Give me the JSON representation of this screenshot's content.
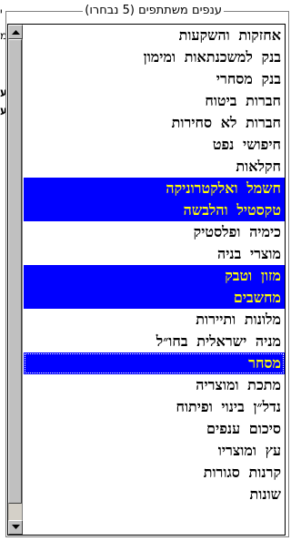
{
  "edge_fragments": [
    "י",
    "מ",
    "ע",
    "ע"
  ],
  "groupbox": {
    "title": "ענפים משתתפים (5 נבחרו)"
  },
  "list": {
    "items": [
      {
        "label": "אחזקות והשקעות",
        "selected": false
      },
      {
        "label": "בנק למשכנתאות ומימון",
        "selected": false
      },
      {
        "label": "בנק מסחרי",
        "selected": false
      },
      {
        "label": "חברות ביטוח",
        "selected": false
      },
      {
        "label": "חברות לא סחירות",
        "selected": false
      },
      {
        "label": "חיפושי נפט",
        "selected": false
      },
      {
        "label": "חקלאות",
        "selected": false
      },
      {
        "label": "חשמל ואלקטרוניקה",
        "selected": true
      },
      {
        "label": "טקסטיל והלבשה",
        "selected": true
      },
      {
        "label": "כימיה ופלסטיק",
        "selected": false
      },
      {
        "label": "מוצרי בניה",
        "selected": false
      },
      {
        "label": "מזון וטבק",
        "selected": true
      },
      {
        "label": "מחשבים",
        "selected": true
      },
      {
        "label": "מלונות ותיירות",
        "selected": false
      },
      {
        "label": "מניה ישראלית בחו״ל",
        "selected": false
      },
      {
        "label": "מסחר",
        "selected": true,
        "focused": true
      },
      {
        "label": "מתכת ומוצריה",
        "selected": false
      },
      {
        "label": "נדל״ן בינוי ופיתוח",
        "selected": false
      },
      {
        "label": "סיכום ענפים",
        "selected": false
      },
      {
        "label": "עץ ומוצריו",
        "selected": false
      },
      {
        "label": "קרנות סגורות",
        "selected": false
      },
      {
        "label": "שונות",
        "selected": false
      }
    ]
  },
  "scrollbar": {
    "position": 0,
    "visible_fraction": 0.96
  },
  "colors": {
    "selection_bg": "#0000ff",
    "selection_text": "#ffff00",
    "face": "#c0c0c0"
  },
  "icons": {
    "scroll_up": "triangle-up-icon",
    "scroll_down": "triangle-down-icon"
  }
}
